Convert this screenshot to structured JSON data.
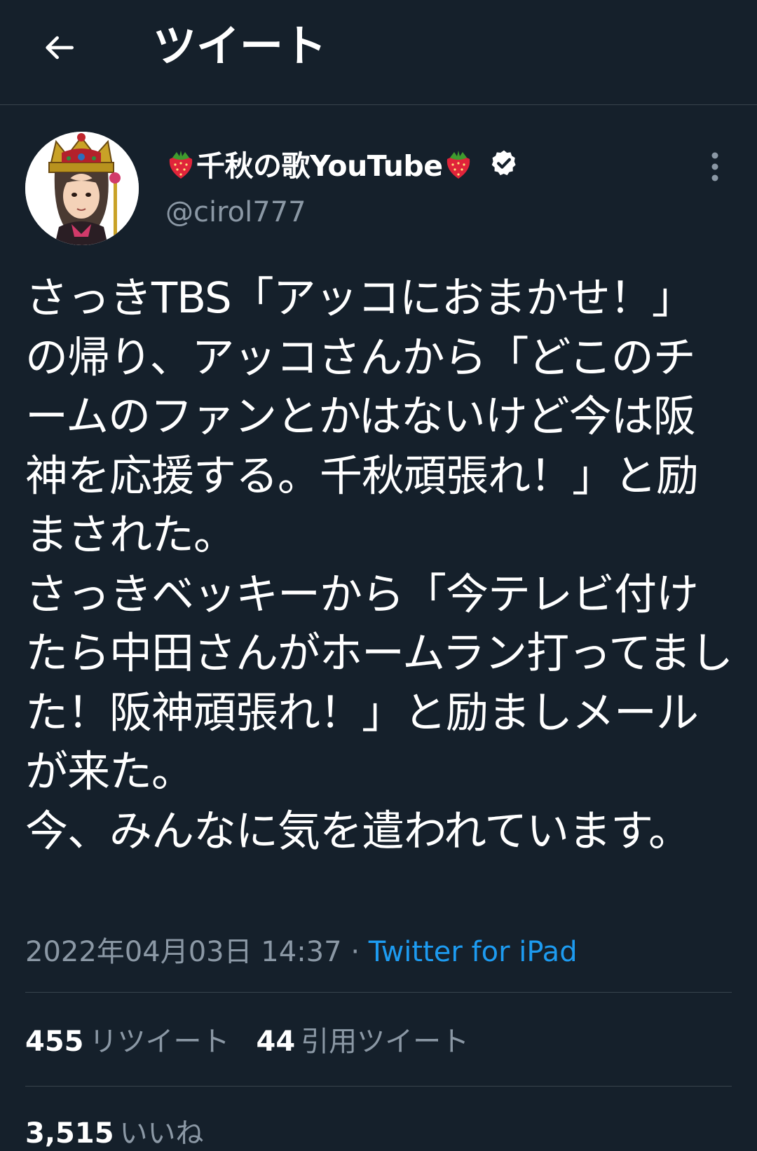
{
  "header": {
    "title": "ツイート",
    "back_icon": "arrow-left-icon"
  },
  "author": {
    "display_name": "千秋の歌YouTube",
    "name_emoji": "strawberry-icon",
    "verified": true,
    "handle": "@cirol777"
  },
  "tweet": {
    "text": "さっきTBS「アッコにおまかせ！」の帰り、アッコさんから「どこのチームのファンとかはないけど今は阪神を応援する。千秋頑張れ！」と励まされた。\nさっきベッキーから「今テレビ付けたら中田さんがホームラン打ってました！阪神頑張れ！」と励ましメールが来た。\n今、みんなに気を遣われています。",
    "datetime": "2022年04月03日 14:37",
    "separator": "·",
    "source": "Twitter for iPad"
  },
  "stats": {
    "retweets_count": "455",
    "retweets_label": "リツイート",
    "quotes_count": "44",
    "quotes_label": "引用ツイート",
    "likes_count": "3,515",
    "likes_label": "いいね"
  },
  "colors": {
    "background": "#15202b",
    "accent": "#1d9bf0",
    "secondary_text": "#8b98a5",
    "divider": "#38444d"
  }
}
